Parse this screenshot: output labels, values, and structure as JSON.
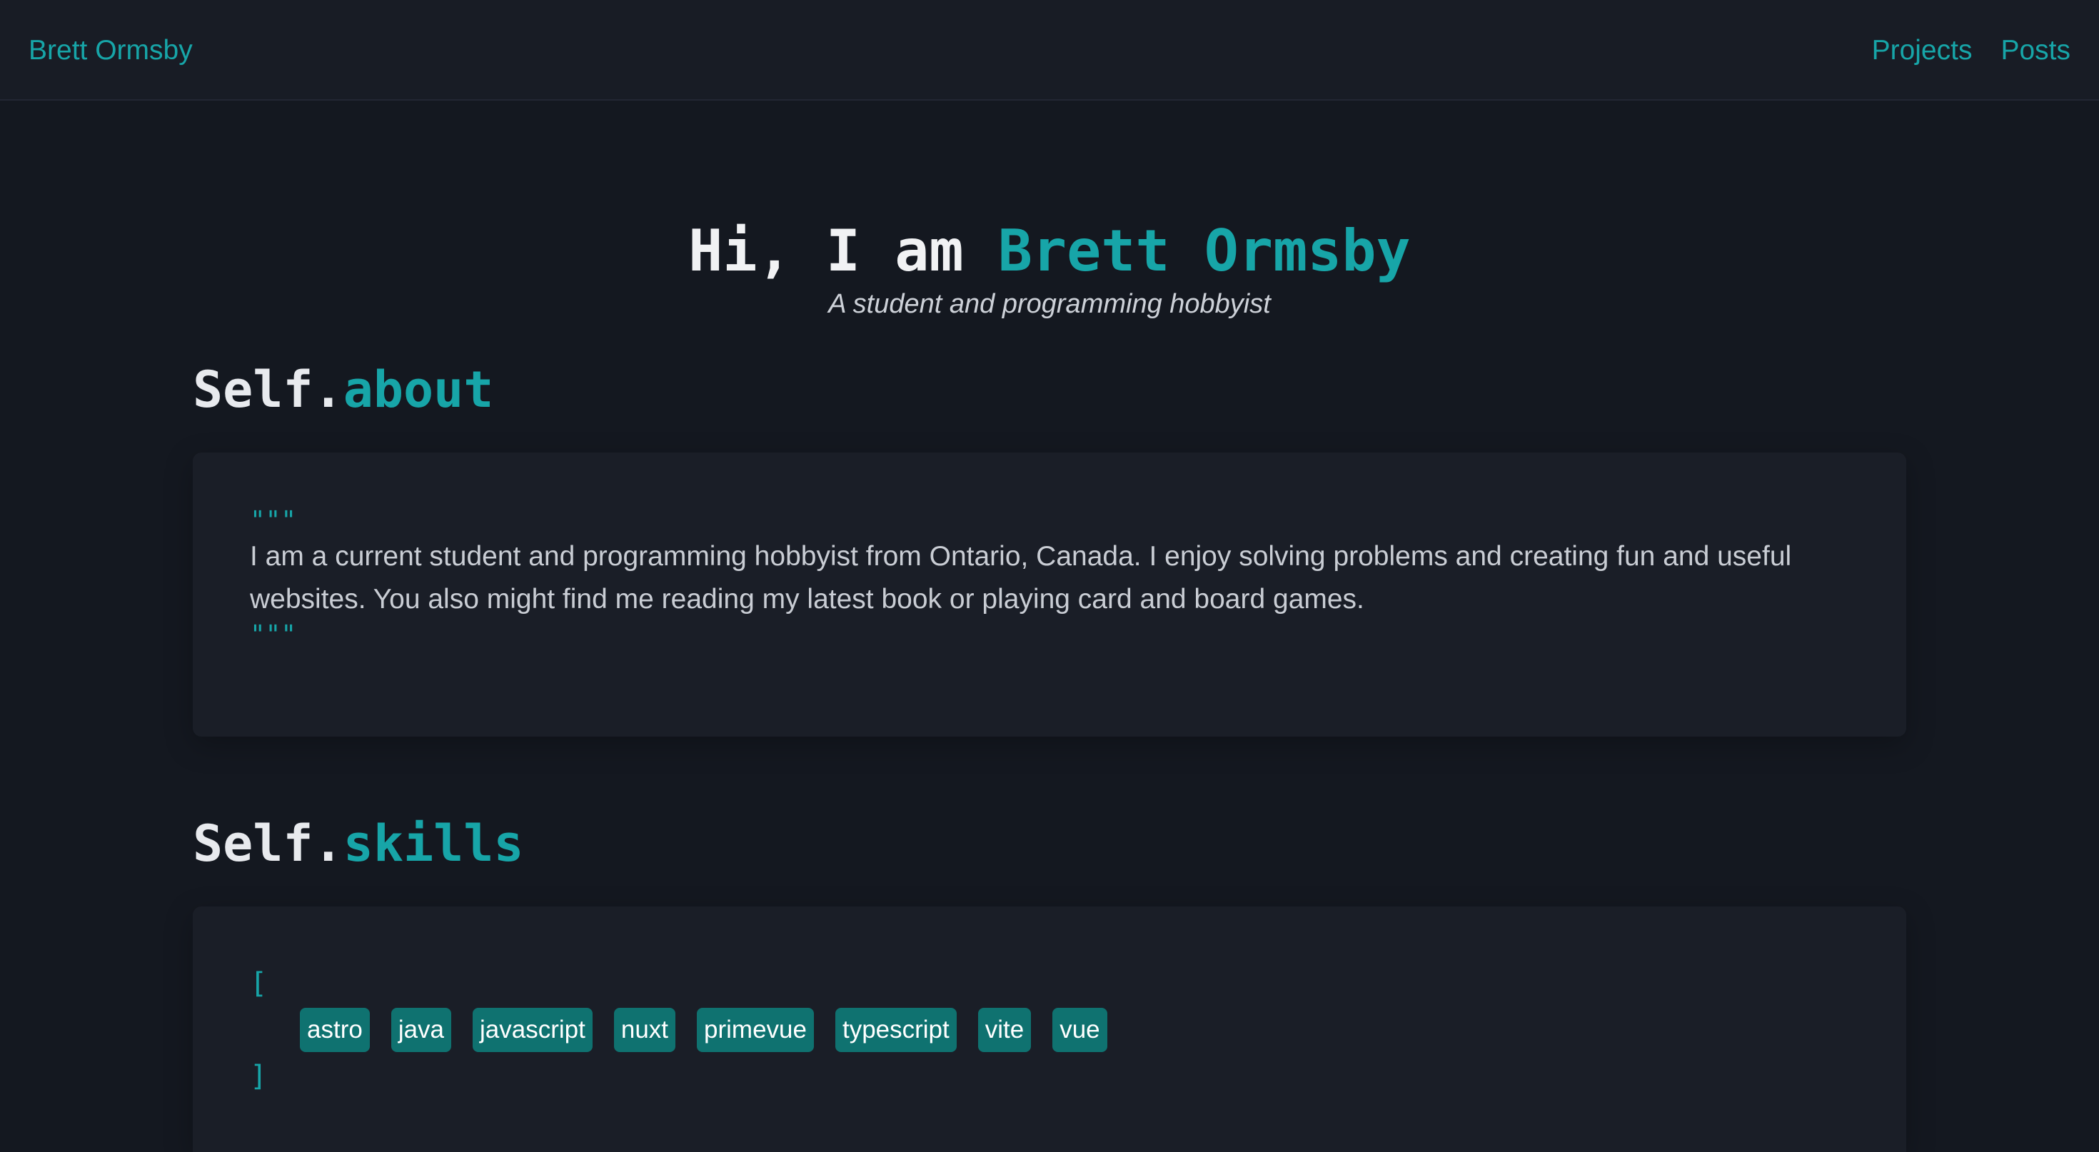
{
  "nav": {
    "brand": "Brett Ormsby",
    "links": [
      "Projects",
      "Posts"
    ]
  },
  "hero": {
    "greeting": "Hi, I am ",
    "name": "Brett Ormsby",
    "subtitle": "A student and programming hobbyist"
  },
  "about": {
    "heading_prefix": "Self.",
    "heading_key": "about",
    "quote_open": "\"\"\"",
    "text": "I am a current student and programming hobbyist from Ontario, Canada. I enjoy solving problems and creating fun and useful websites. You also might find me reading my latest book or playing card and board games.",
    "quote_close": "\"\"\""
  },
  "skills": {
    "heading_prefix": "Self.",
    "heading_key": "skills",
    "bracket_open": "[",
    "items": [
      "astro",
      "java",
      "javascript",
      "nuxt",
      "primevue",
      "typescript",
      "vite",
      "vue"
    ],
    "bracket_close": "]"
  },
  "colors": {
    "accent": "#17a5a8",
    "background": "#141820",
    "navbar": "#181c25",
    "card": "#1a1e27",
    "tag": "#0f7270"
  }
}
